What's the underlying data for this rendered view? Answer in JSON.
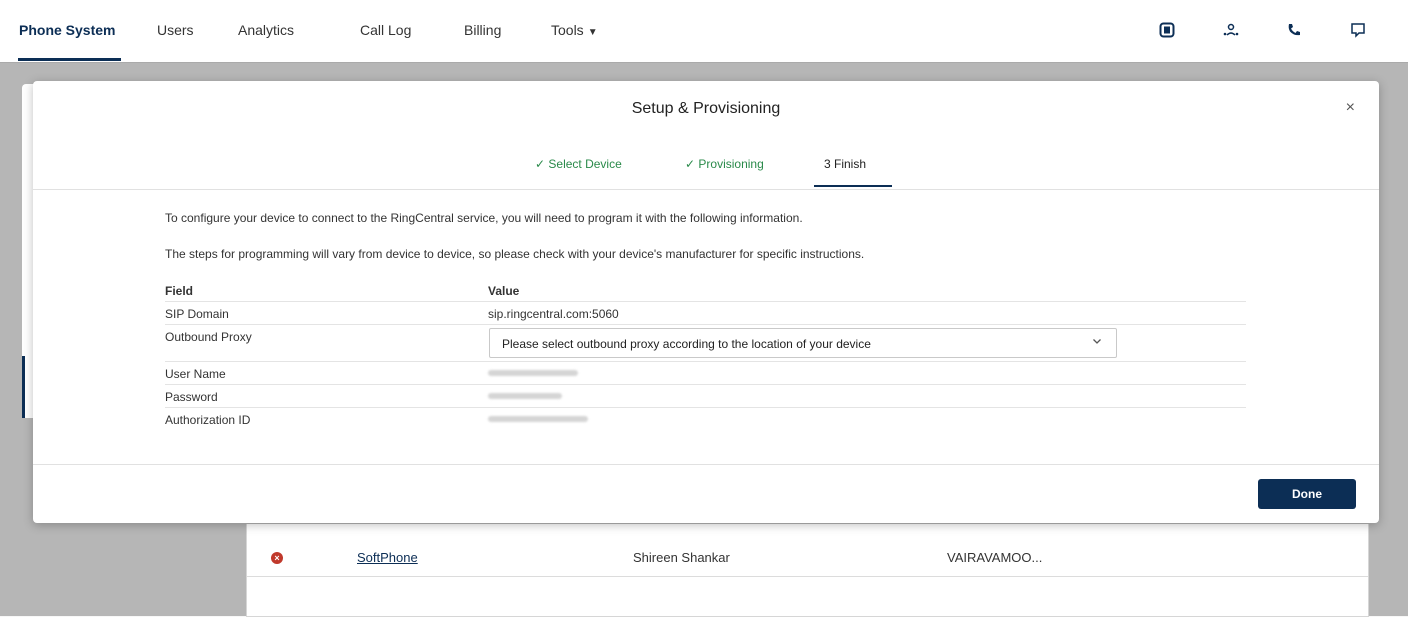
{
  "nav": {
    "items": [
      "Phone System",
      "Users",
      "Analytics",
      "Call Log",
      "Billing",
      "Tools"
    ],
    "icons": [
      "app-icon",
      "people-icon",
      "phone-icon",
      "message-icon"
    ]
  },
  "background": {
    "row": {
      "device": "SoftPhone",
      "user": "Shireen Shankar",
      "department": "VAIRAVAMOO..."
    }
  },
  "modal": {
    "title": "Setup & Provisioning",
    "close": "×",
    "steps": [
      {
        "label": "✓ Select Device",
        "state": "done"
      },
      {
        "label": "✓ Provisioning",
        "state": "done"
      },
      {
        "label": "3  Finish",
        "state": "current"
      }
    ],
    "intro1": "To configure your device to connect to the RingCentral service, you will need to program it with the following information.",
    "intro2": "The steps for programming will vary from device to device, so please check with your device's manufacturer for specific instructions.",
    "table": {
      "header": {
        "field": "Field",
        "value": "Value"
      },
      "sip_domain": {
        "field": "SIP Domain",
        "value": "sip.ringcentral.com:5060"
      },
      "outbound_proxy": {
        "field": "Outbound Proxy",
        "placeholder": "Please select outbound proxy according to the location of your device"
      },
      "user_name": {
        "field": "User Name"
      },
      "password": {
        "field": "Password"
      },
      "authorization_id": {
        "field": "Authorization ID"
      }
    },
    "done_label": "Done"
  },
  "colors": {
    "brand": "#0c2e55",
    "success": "#2a8a4a",
    "error": "#c0392b"
  }
}
